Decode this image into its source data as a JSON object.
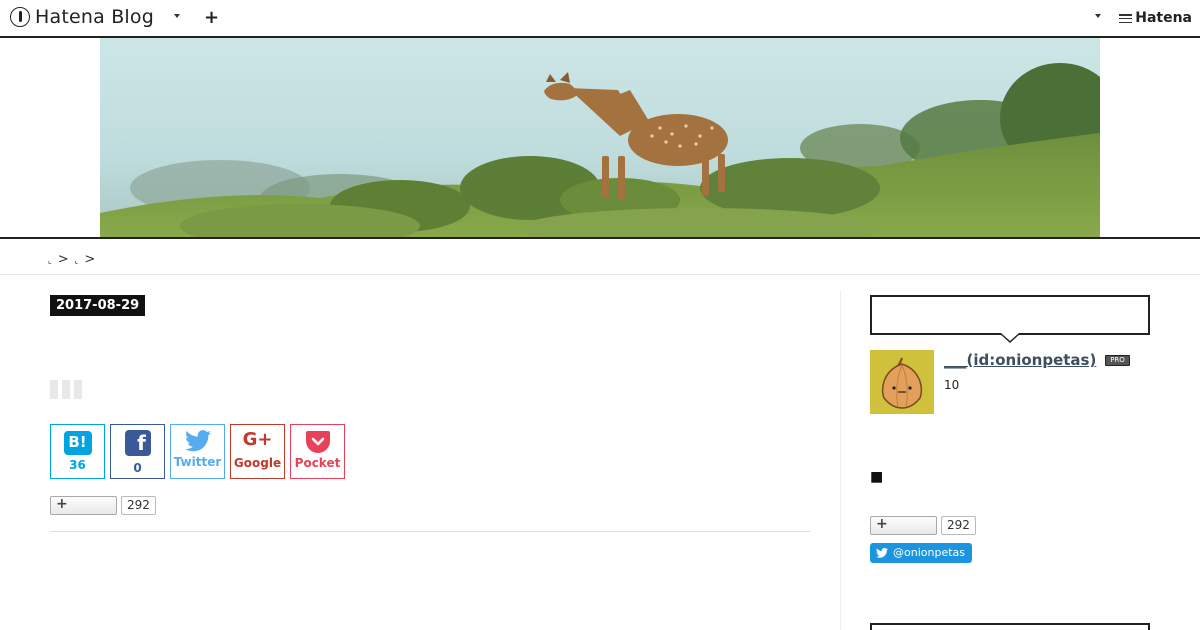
{
  "globalbar": {
    "brand": "Hatena Blog",
    "add_label": "+",
    "hatena_label": "Hatena"
  },
  "breadcrumb": {
    "items": [
      "⌞",
      "⌞"
    ],
    "separator": ">"
  },
  "entry": {
    "date": "2017-08-29",
    "share": {
      "hatena_bookmark": {
        "label": "B!",
        "count": "36"
      },
      "facebook": {
        "label": "f",
        "count": "0"
      },
      "twitter": {
        "label": "Twitter"
      },
      "google": {
        "label": "Google",
        "icon_text": "G+"
      },
      "pocket": {
        "label": "Pocket"
      }
    },
    "subscribe": {
      "plus": "+",
      "count": "292"
    }
  },
  "sidebar": {
    "profile": {
      "name": "___(id:onionpetas)",
      "badge": "PRO",
      "count": "10"
    },
    "section_bullet": "■",
    "subscribe": {
      "plus": "+",
      "count": "292"
    },
    "twitter_follow": "@onionpetas"
  },
  "colors": {
    "hatena_bookmark": "#00a4de",
    "facebook": "#3b5998",
    "twitter": "#55acee",
    "google": "#c0392b",
    "pocket": "#e9415a",
    "date_badge_bg": "#111111",
    "avatar_bg": "#cfc13b"
  }
}
